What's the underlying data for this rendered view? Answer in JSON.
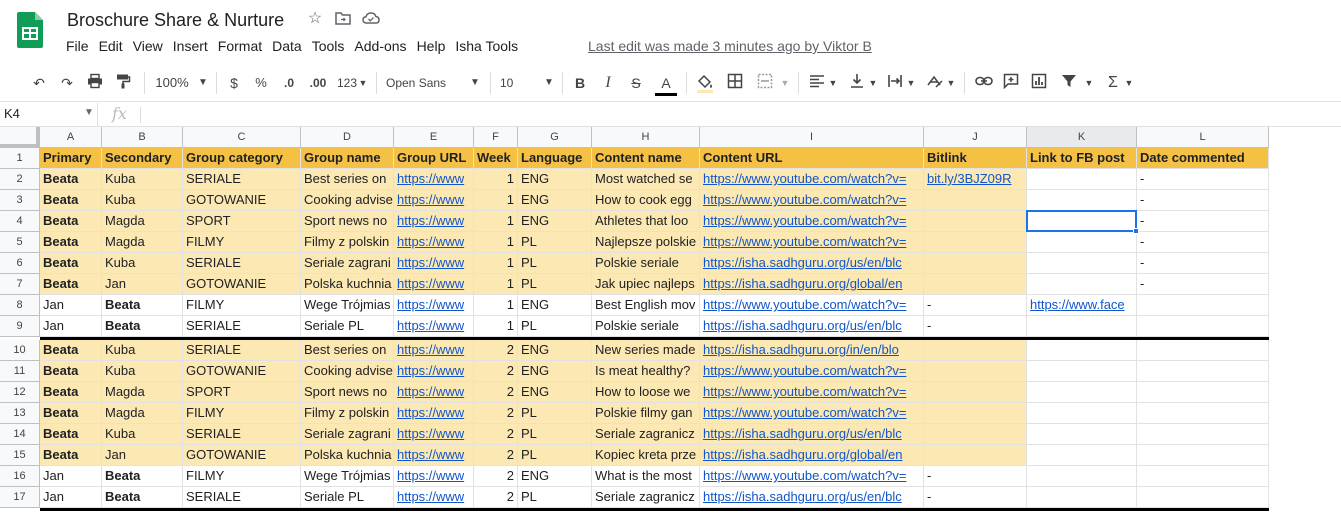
{
  "doc": {
    "title": "Broschure Share & Nurture",
    "last_edit": "Last edit was made 3 minutes ago by Viktor B"
  },
  "menu": [
    "File",
    "Edit",
    "View",
    "Insert",
    "Format",
    "Data",
    "Tools",
    "Add-ons",
    "Help",
    "Isha Tools"
  ],
  "toolbar": {
    "zoom": "100%",
    "currency": "$",
    "percent": "%",
    "dec_less": ".0",
    "dec_more": ".00",
    "format": "123",
    "font": "Open Sans",
    "font_size": "10",
    "bold": "B",
    "italic": "I",
    "strike": "S",
    "text_color": "A"
  },
  "formula_bar": {
    "cell_ref": "K4",
    "fx": "fx"
  },
  "columns": [
    "A",
    "B",
    "C",
    "D",
    "E",
    "F",
    "G",
    "H",
    "I",
    "J",
    "K",
    "L"
  ],
  "header_row": {
    "num": "1",
    "cells": [
      "Primary",
      "Secondary",
      "Group category",
      "Group name",
      "Group URL",
      "Week",
      "Language",
      "Content name",
      "Content URL",
      "Bitlink",
      "Link to FB post",
      "Date commented"
    ]
  },
  "rows": [
    {
      "num": "2",
      "cells": [
        "Beata",
        "Kuba",
        "SERIALE",
        "Best series on",
        "https://www",
        "1",
        "ENG",
        "Most watched se",
        "https://www.youtube.com/watch?v=",
        "bit.ly/3BJZ09R",
        "",
        "-"
      ]
    },
    {
      "num": "3",
      "cells": [
        "Beata",
        "Kuba",
        "GOTOWANIE",
        "Cooking advise",
        "https://www",
        "1",
        "ENG",
        "How to cook egg",
        "https://www.youtube.com/watch?v=",
        "",
        "",
        "-"
      ]
    },
    {
      "num": "4",
      "cells": [
        "Beata",
        "Magda",
        "SPORT",
        "Sport news no",
        "https://www",
        "1",
        "ENG",
        "Athletes that loo",
        "https://www.youtube.com/watch?v=",
        "",
        "",
        "-"
      ]
    },
    {
      "num": "5",
      "cells": [
        "Beata",
        "Magda",
        "FILMY",
        "Filmy z polskin",
        "https://www",
        "1",
        "PL",
        "Najlepsze polskie",
        "https://www.youtube.com/watch?v=",
        "",
        "",
        "-"
      ]
    },
    {
      "num": "6",
      "cells": [
        "Beata",
        "Kuba",
        "SERIALE",
        "Seriale zagrani",
        "https://www",
        "1",
        "PL",
        "Polskie seriale",
        "https://isha.sadhguru.org/us/en/blc",
        "",
        "",
        "-"
      ]
    },
    {
      "num": "7",
      "cells": [
        "Beata",
        "Jan",
        "GOTOWANIE",
        "Polska kuchnia",
        "https://www",
        "1",
        "PL",
        "Jak upiec najleps",
        "https://isha.sadhguru.org/global/en",
        "",
        "",
        "-"
      ]
    },
    {
      "num": "8",
      "cells": [
        "Jan",
        "Beata",
        "FILMY",
        "Wege Trójmias",
        "https://www",
        "1",
        "ENG",
        "Best English mov",
        "https://www.youtube.com/watch?v=",
        "-",
        "https://www.face",
        ""
      ]
    },
    {
      "num": "9",
      "cells": [
        "Jan",
        "Beata",
        "SERIALE",
        "Seriale PL",
        "https://www",
        "1",
        "PL",
        "Polskie seriale",
        "https://isha.sadhguru.org/us/en/blc",
        "-",
        "",
        ""
      ]
    },
    {
      "num": "10",
      "cells": [
        "Beata",
        "Kuba",
        "SERIALE",
        "Best series on",
        "https://www",
        "2",
        "ENG",
        "New series made",
        "https://isha.sadhguru.org/in/en/blo",
        "",
        "",
        ""
      ]
    },
    {
      "num": "11",
      "cells": [
        "Beata",
        "Kuba",
        "GOTOWANIE",
        "Cooking advise",
        "https://www",
        "2",
        "ENG",
        "Is meat healthy?",
        "https://www.youtube.com/watch?v=",
        "",
        "",
        ""
      ]
    },
    {
      "num": "12",
      "cells": [
        "Beata",
        "Magda",
        "SPORT",
        "Sport news no",
        "https://www",
        "2",
        "ENG",
        "How to loose we",
        "https://www.youtube.com/watch?v=",
        "",
        "",
        ""
      ]
    },
    {
      "num": "13",
      "cells": [
        "Beata",
        "Magda",
        "FILMY",
        "Filmy z polskin",
        "https://www",
        "2",
        "PL",
        "Polskie filmy gan",
        "https://www.youtube.com/watch?v=",
        "",
        "",
        ""
      ]
    },
    {
      "num": "14",
      "cells": [
        "Beata",
        "Kuba",
        "SERIALE",
        "Seriale zagrani",
        "https://www",
        "2",
        "PL",
        "Seriale zagranicz",
        "https://isha.sadhguru.org/us/en/blc",
        "",
        "",
        ""
      ]
    },
    {
      "num": "15",
      "cells": [
        "Beata",
        "Jan",
        "GOTOWANIE",
        "Polska kuchnia",
        "https://www",
        "2",
        "PL",
        "Kopiec kreta prze",
        "https://isha.sadhguru.org/global/en",
        "",
        "",
        ""
      ]
    },
    {
      "num": "16",
      "cells": [
        "Jan",
        "Beata",
        "FILMY",
        "Wege Trójmias",
        "https://www",
        "2",
        "ENG",
        "What is the most",
        "https://www.youtube.com/watch?v=",
        "-",
        "",
        ""
      ]
    },
    {
      "num": "17",
      "cells": [
        "Jan",
        "Beata",
        "SERIALE",
        "Seriale PL",
        "https://www",
        "2",
        "PL",
        "Seriale zagranicz",
        "https://isha.sadhguru.org/us/en/blc",
        "-",
        "",
        ""
      ]
    }
  ],
  "colors": {
    "header_fill": "#f4c144",
    "row_fill": "#fce8b2",
    "link": "#1155cc",
    "selection": "#1a73e8"
  }
}
